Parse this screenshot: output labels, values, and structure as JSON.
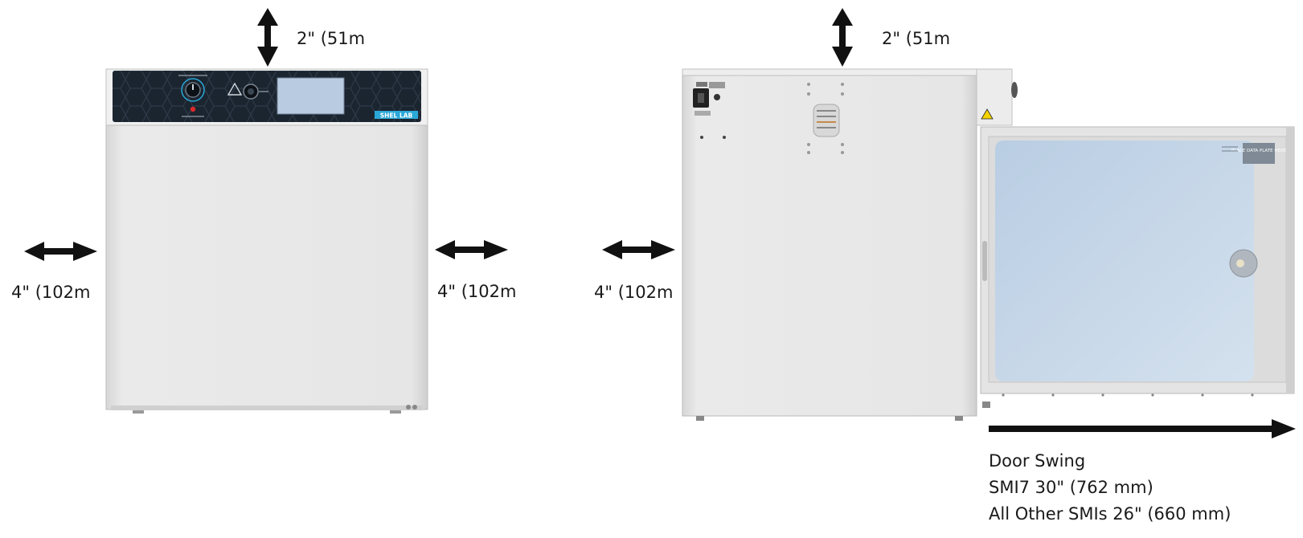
{
  "front_view": {
    "top_clearance": "2\" (51m",
    "left_clearance": "4\" (102m",
    "right_clearance": "4\" (102m",
    "brand_logo": "SHEL LAB"
  },
  "side_view": {
    "top_clearance": "2\" (51m",
    "left_clearance": "4\" (102m",
    "window_sticker": "PLACE DATA PLATE HERE",
    "door_swing": {
      "title": "Door Swing",
      "line1": "SMI7 30\" (762 mm)",
      "line2": "All Other SMIs 26\" (660 mm)"
    }
  },
  "colors": {
    "cabinet": "#e6e6e6",
    "control_panel": "#1b2530",
    "accent": "#2aa8d8",
    "arrow": "#111111",
    "glass": "#c9d9ea"
  }
}
